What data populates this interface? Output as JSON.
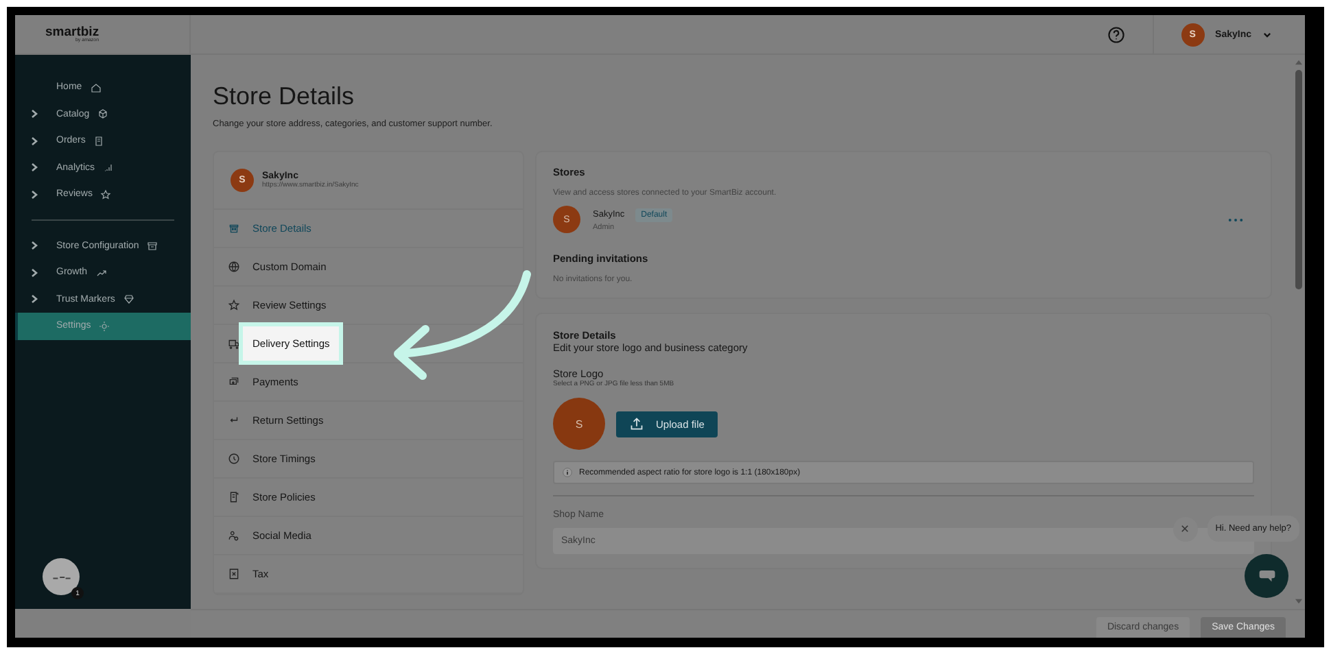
{
  "header": {
    "logo": "smartbiz",
    "logo_sub": "by amazon",
    "user": {
      "initial": "S",
      "name": "SakyInc"
    }
  },
  "sidebar": {
    "groups": [
      {
        "items": [
          {
            "label": "Home",
            "expandable": false,
            "selected": false
          },
          {
            "label": "Catalog",
            "expandable": true,
            "selected": false
          },
          {
            "label": "Orders",
            "expandable": true,
            "selected": false
          },
          {
            "label": "Analytics",
            "expandable": true,
            "selected": false
          },
          {
            "label": "Reviews",
            "expandable": true,
            "selected": false
          }
        ]
      },
      {
        "items": [
          {
            "label": "Store Configuration",
            "expandable": true,
            "selected": false
          },
          {
            "label": "Growth",
            "expandable": true,
            "selected": false
          },
          {
            "label": "Trust Markers",
            "expandable": true,
            "selected": false
          },
          {
            "label": "Settings",
            "expandable": false,
            "selected": true
          }
        ]
      }
    ],
    "notification_badge": "1"
  },
  "page": {
    "title": "Store Details",
    "subtitle": "Change your store address, categories, and customer support number."
  },
  "store_card": {
    "initial": "S",
    "name": "SakyInc",
    "url": "https://www.smartbiz.in/SakyInc"
  },
  "settings_menu": [
    {
      "label": "Store Details",
      "selected": true,
      "highlighted": false
    },
    {
      "label": "Custom Domain",
      "selected": false,
      "highlighted": false
    },
    {
      "label": "Review Settings",
      "selected": false,
      "highlighted": false
    },
    {
      "label": "Delivery Settings",
      "selected": false,
      "highlighted": true
    },
    {
      "label": "Payments",
      "selected": false,
      "highlighted": false
    },
    {
      "label": "Return Settings",
      "selected": false,
      "highlighted": false
    },
    {
      "label": "Store Timings",
      "selected": false,
      "highlighted": false
    },
    {
      "label": "Store Policies",
      "selected": false,
      "highlighted": false
    },
    {
      "label": "Social Media",
      "selected": false,
      "highlighted": false
    },
    {
      "label": "Tax",
      "selected": false,
      "highlighted": false
    }
  ],
  "stores_panel": {
    "title": "Stores",
    "description": "View and access stores connected to your SmartBiz account.",
    "stores": [
      {
        "initial": "S",
        "name": "SakyInc",
        "badge": "Default",
        "role": "Admin"
      }
    ],
    "pending_title": "Pending invitations",
    "pending_text": "No invitations for you."
  },
  "store_details": {
    "title": "Store Details",
    "subtitle": "Edit your store logo and business category",
    "logo_label": "Store Logo",
    "logo_hint": "Select a PNG or JPG file less than 5MB",
    "logo_initial": "S",
    "upload_button": "Upload file",
    "info": "Recommended aspect ratio for store logo is 1:1 (180x180px)",
    "fields": [
      {
        "label": "Shop Name",
        "value": "SakyInc"
      }
    ]
  },
  "chat": {
    "bubble": "Hi. Need any help?"
  },
  "footer": {
    "buttons": [
      {
        "label": "Discard changes",
        "kind": "secondary"
      },
      {
        "label": "Save Changes",
        "kind": "primary"
      }
    ]
  }
}
